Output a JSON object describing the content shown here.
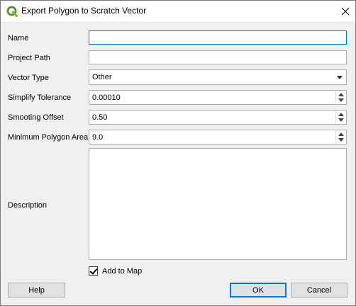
{
  "window": {
    "title": "Export Polygon to Scratch Vector",
    "icon": "qgis-logo-icon",
    "accent_color": "#0078d7"
  },
  "form": {
    "name_label": "Name",
    "name_value": "",
    "project_path_label": "Project Path",
    "project_path_value": "",
    "vector_type_label": "Vector Type",
    "vector_type_value": "Other",
    "simplify_tolerance_label": "Simplify Tolerance",
    "simplify_tolerance_value": "0.00010",
    "smoothing_offset_label": "Smooting Offset",
    "smoothing_offset_value": "0.50",
    "min_polygon_area_label": "Minimum Polygon Area",
    "min_polygon_area_value": "9.0",
    "description_label": "Description",
    "description_value": "",
    "add_to_map_label": "Add to Map",
    "add_to_map_checked": true
  },
  "buttons": {
    "help": "Help",
    "ok": "OK",
    "cancel": "Cancel"
  }
}
